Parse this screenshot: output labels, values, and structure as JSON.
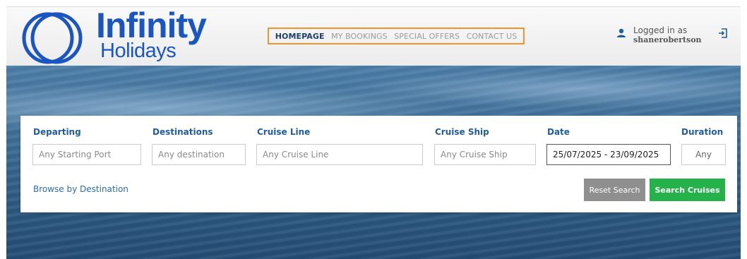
{
  "brand": {
    "name_line1": "Infinity",
    "name_line2": "Holidays",
    "color": "#1a55c0"
  },
  "nav": {
    "items": [
      {
        "label": "HOMEPAGE",
        "active": true
      },
      {
        "label": "MY BOOKINGS",
        "active": false
      },
      {
        "label": "SPECIAL OFFERS",
        "active": false
      },
      {
        "label": "CONTACT US",
        "active": false
      }
    ],
    "highlight_color": "#f0952e"
  },
  "user": {
    "prefix": "Logged in as",
    "username": "shanerobertson",
    "icon": "user-icon",
    "logout_icon": "logout-icon"
  },
  "search": {
    "departing": {
      "label": "Departing",
      "placeholder": "Any Starting Port",
      "value": ""
    },
    "destinations": {
      "label": "Destinations",
      "placeholder": "Any destination",
      "value": ""
    },
    "cruise_line": {
      "label": "Cruise Line",
      "placeholder": "Any Cruise Line",
      "value": ""
    },
    "cruise_ship": {
      "label": "Cruise Ship",
      "placeholder": "Any Cruise Ship",
      "value": ""
    },
    "date": {
      "label": "Date",
      "placeholder": "",
      "value": "25/07/2025 - 23/09/2025"
    },
    "duration": {
      "label": "Duration",
      "placeholder": "",
      "value": "Any"
    },
    "browse_link": "Browse by Destination",
    "reset_label": "Reset Search",
    "search_label": "Search Cruises",
    "label_color": "#1f5da0",
    "search_color": "#25b24a",
    "reset_color": "#8f8f8f"
  }
}
